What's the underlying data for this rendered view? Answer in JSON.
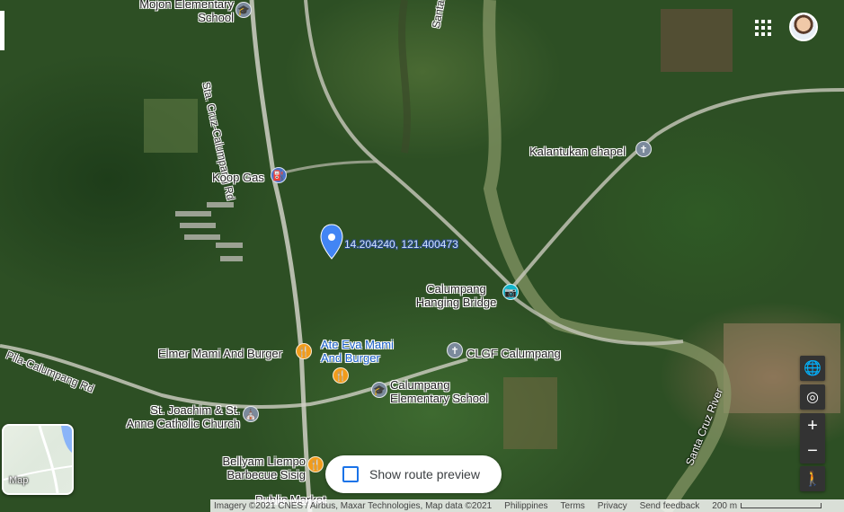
{
  "roads": {
    "sta_cruz": "Sta. Cruz-Calumpang Rd",
    "pila": "Pila-Calumpang Rd",
    "santa_top": "Santa"
  },
  "places": {
    "mojon_school": "Mojon Elementary\nSchool",
    "koop_gas": "Koop Gas",
    "kalantukan": "Kalantukan chapel",
    "bridge": "Calumpang\nHanging Bridge",
    "elmer": "Elmer Mami And Burger",
    "ate_eva": "Ate Eva Mami\nAnd Burger",
    "clgf": "CLGF Calumpang",
    "calumpang_school": "Calumpang\nElementary School",
    "st_joachim": "St. Joachim & St.\nAnne Catholic Church",
    "bellyam": "Bellyam Liempo\nBarbecue Sisig",
    "public_market": "Public Market",
    "river": "Santa Cruz River"
  },
  "pin": {
    "coordinates": "14.204240, 121.400473"
  },
  "minimap": {
    "label": "Map"
  },
  "route": {
    "label": "Show route preview"
  },
  "footer": {
    "imagery": "Imagery ©2021 CNES / Airbus, Maxar Technologies, Map data ©2021",
    "country": "Philippines",
    "terms": "Terms",
    "privacy": "Privacy",
    "feedback": "Send feedback",
    "scale": "200 m"
  },
  "icons": {
    "apps": "apps-grid-icon",
    "layers": "globe-icon",
    "location": "my-location-icon",
    "zoom_in": "plus-icon",
    "zoom_out": "minus-icon",
    "pegman": "pegman-icon"
  },
  "colors": {
    "pin": "#4285f4",
    "food_poi": "#f29c1b",
    "school_poi": "#7b8a9c",
    "attraction_poi": "#12b5cb",
    "link_label": "#1a5fc7"
  }
}
